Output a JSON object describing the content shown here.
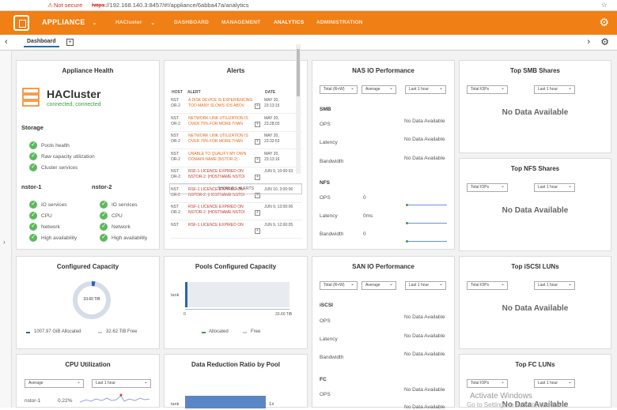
{
  "browser": {
    "warning": "Not secure",
    "url_scheme": "https",
    "url_rest": "://192.168.140.3:8457/#!/appliance/6abba47a/analytics"
  },
  "topnav": {
    "app": "APPLIANCE",
    "cluster": "HACluster",
    "items": [
      "DASHBOARD",
      "MANAGEMENT",
      "ANALYTICS",
      "ADMINISTRATION"
    ],
    "active": "ANALYTICS"
  },
  "subbar": {
    "tab": "Dashboard"
  },
  "health": {
    "title": "Appliance Health",
    "cluster": "HACluster",
    "status": "connected, connected",
    "storage_title": "Storage",
    "storage_items": [
      "Pools health",
      "Raw capacity utilization",
      "Cluster services"
    ],
    "node1": "nstor-1",
    "node2": "nstor-2",
    "node_items": [
      "IO services",
      "CPU",
      "Network",
      "High availability"
    ]
  },
  "alerts": {
    "title": "Alerts",
    "headers": [
      "HOST",
      "ALERT",
      "DATE"
    ],
    "rows": [
      {
        "host": "NST\nOR-2",
        "msg": "A DISK DEVICE IS EXPERIENCING TOO MANY SLOWS IOS ABOV",
        "date": "MAY 20,\n23:13:15"
      },
      {
        "host": "NST\nOR-2",
        "msg": "NETWORK LINK UTILIZATION IS OVER 75% FOR MORE THAN",
        "date": "MAY 20,\n23:28:03"
      },
      {
        "host": "NST\nOR-2",
        "msg": "NETWORK LINK UTILIZATION IS OVER 75% FOR MORE THAN",
        "date": "MAY 20,\n23:32:53"
      },
      {
        "host": "NST\nOR-2",
        "msg": "UNABLE TO QUALIFY MY OWN DOMAIN NAME (NSTOR-2) -",
        "date": "MAY 20,\n23:13:16"
      },
      {
        "host": "NST\nOR-2",
        "msg": "RSF-1 LICENCE EXPIRED ON NSTOR-2. (HOSTNAME NSTOI",
        "date": "JUN 9, 10:00:03"
      },
      {
        "host": "NST\nOR-2",
        "msg": "RSF-1 LICENCE EXPIRED ON NSTOR-2. (HOSTNAME NSTOI",
        "date": "JUN 10, 3:00:06"
      },
      {
        "host": "NST\nOR-2",
        "msg": "RSF-1 LICENCE EXPIRED ON NSTOR-2. (HOSTNAME NSTOI",
        "date": "JUN 9, 13:00:06"
      },
      {
        "host": "NST",
        "msg": "RSF-1 LICENCE EXPIRED ON",
        "date": "JUN 9, 12:00:05"
      }
    ],
    "show_all": "SHOW ALL ALERTS"
  },
  "nas": {
    "title": "NAS IO Performance",
    "filters": [
      "Total (R+W)",
      "Average",
      "Last 1 hour"
    ],
    "smb": "SMB",
    "nfs": "NFS",
    "metrics": [
      "OPS",
      "Latency",
      "Bandwidth"
    ],
    "no_data": "No Data Available",
    "nfs_values": [
      "0",
      "0ms",
      "0"
    ]
  },
  "smb_shares": {
    "title": "Top SMB Shares",
    "filters": [
      "Total IOPs",
      "Last 1 hour"
    ],
    "no_data": "No Data Available"
  },
  "nfs_shares": {
    "title": "Top NFS Shares",
    "filters": [
      "Total IOPs",
      "Last 1 hour"
    ],
    "no_data": "No Data Available"
  },
  "capacity": {
    "title": "Configured Capacity",
    "center": "33.60 TiB",
    "allocated": "1007.97 GiB Allocated",
    "free": "32.62 TiB Free",
    "allocated_fraction": 0.03
  },
  "pools": {
    "title": "Pools Configured Capacity",
    "pool": "tank",
    "axis_min": "0",
    "axis_max": "33.60 TiB",
    "legend": [
      "Allocated",
      "Free"
    ]
  },
  "san": {
    "title": "SAN IO Performance",
    "filters": [
      "Total (R+W)",
      "Average",
      "Last 1 hour"
    ],
    "iscsi": "iSCSI",
    "fc": "FC",
    "metrics": [
      "OPS",
      "Latency",
      "Bandwidth"
    ],
    "no_data": "No Data Available"
  },
  "iscsi_luns": {
    "title": "Top iSCSI LUNs",
    "filters": [
      "Total IOPs",
      "Last 1 hour"
    ],
    "no_data": "No Data Available"
  },
  "fc_luns": {
    "title": "Top FC LUNs",
    "filters": [
      "Total IOPs",
      "Last 1 hour"
    ],
    "no_data": "No Data Available"
  },
  "cpu": {
    "title": "CPU Utilization",
    "filters": [
      "Average",
      "Last 1 hour"
    ],
    "node": "nstor-1",
    "value": "0.22%"
  },
  "reduction": {
    "title": "Data Reduction Ratio by Pool",
    "pool": "tank",
    "ratio": "1x"
  },
  "os": {
    "watermark": "Activate Windows",
    "watermark_sub": "Go to Settings to activate Windows."
  }
}
